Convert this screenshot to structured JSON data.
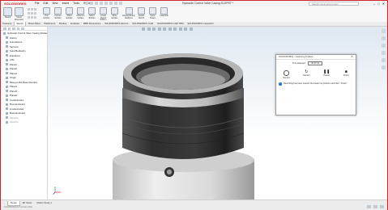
{
  "app": {
    "logo": "SOLIDWORKS",
    "menu": [
      "File",
      "Edit",
      "View",
      "Insert",
      "Tools",
      "Window"
    ],
    "document_title": "Hydraulic Control Valve Casing.SLDPRT *",
    "search_placeholder": "Search Community Forum",
    "window_controls": [
      "–",
      "□",
      "✕"
    ]
  },
  "ribbon": {
    "buttons": [
      {
        "label": "Sketch",
        "icon": "sketch-icon"
      },
      {
        "label": "Smart Dimension",
        "icon": "smart-dimension-icon"
      },
      {
        "label": "Trim Entities",
        "icon": "trim-icon"
      },
      {
        "label": "Convert Entities",
        "icon": "convert-icon"
      },
      {
        "label": "Offset Entities",
        "icon": "offset-icon"
      },
      {
        "label": "Offset On Surface",
        "icon": "offset-surface-icon"
      },
      {
        "label": "Mirror Entities",
        "icon": "mirror-icon"
      },
      {
        "label": "Linear Sketch Pattern",
        "icon": "pattern-icon"
      },
      {
        "label": "Move Entities",
        "icon": "move-icon"
      },
      {
        "label": "Display/Delete Relations",
        "icon": "relations-icon"
      },
      {
        "label": "Repair Sketch",
        "icon": "repair-icon"
      },
      {
        "label": "Quick Snaps",
        "icon": "snaps-icon"
      },
      {
        "label": "Instant2D",
        "icon": "instant2d-icon"
      }
    ]
  },
  "tabs": [
    {
      "label": "Features",
      "active": false
    },
    {
      "label": "Sketch",
      "active": true
    },
    {
      "label": "Sheet Metal",
      "active": false
    },
    {
      "label": "Weldments",
      "active": false
    },
    {
      "label": "Markup",
      "active": false
    },
    {
      "label": "Evaluate",
      "active": false
    },
    {
      "label": "MBD Dimensions",
      "active": false
    },
    {
      "label": "SOLIDWORKS Add-Ins",
      "active": false
    },
    {
      "label": "SOLIDWORKS CAM",
      "active": false
    },
    {
      "label": "SOLIDWORKS CAM TBM",
      "active": false
    },
    {
      "label": "SOLIDWORKS Inspection",
      "active": false
    }
  ],
  "tree": {
    "items": [
      {
        "label": "Hydraulic Control Valve Casing (Defau",
        "icon": "part-icon",
        "dim": false
      },
      {
        "label": "History",
        "icon": "history-icon",
        "dim": false
      },
      {
        "label": "Annotations",
        "icon": "annotations-icon",
        "dim": false
      },
      {
        "label": "Sensors",
        "icon": "sensors-icon",
        "dim": false
      },
      {
        "label": "Solid Bodies(1)",
        "icon": "solid-bodies-icon",
        "dim": false
      },
      {
        "label": "Equations",
        "icon": "equations-icon",
        "dim": false
      },
      {
        "label": "AISI",
        "icon": "material-icon",
        "dim": false
      },
      {
        "label": "Plane1",
        "icon": "plane-icon",
        "dim": false
      },
      {
        "label": "Plane2",
        "icon": "plane-icon",
        "dim": false
      },
      {
        "label": "Plane3",
        "icon": "plane-icon",
        "dim": false
      },
      {
        "label": "Origin",
        "icon": "origin-icon",
        "dim": false
      },
      {
        "label": "Base-profile Base Revolve",
        "icon": "revolve-icon",
        "dim": false
      },
      {
        "label": "Plane4",
        "icon": "plane-icon",
        "dim": false
      },
      {
        "label": "Plane5",
        "icon": "plane-icon",
        "dim": false
      },
      {
        "label": "Plane6",
        "icon": "plane-icon",
        "dim": false
      },
      {
        "label": "Cut-Extrude1",
        "icon": "cut-extrude-icon",
        "dim": false
      },
      {
        "label": "Boss-Extrude1",
        "icon": "boss-extrude-icon",
        "dim": false
      },
      {
        "label": "Cut-Extrude2",
        "icon": "cut-extrude-icon",
        "dim": false
      },
      {
        "label": "Boss-Extrude2",
        "icon": "boss-extrude-icon",
        "dim": false
      },
      {
        "label": "Sketch1",
        "icon": "sketch-icon",
        "dim": true
      },
      {
        "label": "Sketch2",
        "icon": "sketch-icon",
        "dim": true
      }
    ]
  },
  "dialog": {
    "title": "SOLIDWORKS - Capturing Problem",
    "close": "✕",
    "elapsed_label": "Time Elapsed:",
    "elapsed_value": "00:07:11",
    "buttons": [
      {
        "label": "Record",
        "glyph": "●"
      },
      {
        "label": "Restart",
        "glyph": "↻"
      },
      {
        "label": "Pause",
        "glyph": "❚❚"
      },
      {
        "label": "Finish",
        "glyph": "■"
      }
    ],
    "message": "Recording has been started. Recreate the problem and then \"Finish.\""
  },
  "bottom": {
    "tabs": [
      {
        "label": "Model",
        "active": true
      },
      {
        "label": "3D Views",
        "active": false
      },
      {
        "label": "Motion Study 1",
        "active": false
      }
    ],
    "status_text": "SOLIDWORKS Premium 2021"
  },
  "colors": {
    "brand": "#d4252d",
    "viewport_top": "#dfe8f0",
    "model_dark": "#3a3a3a"
  }
}
